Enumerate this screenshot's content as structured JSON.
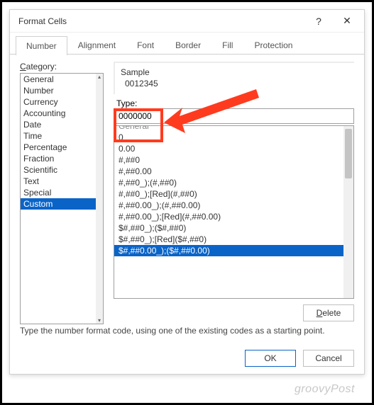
{
  "window": {
    "title": "Format Cells",
    "help": "?",
    "close": "✕"
  },
  "tabs": [
    "Number",
    "Alignment",
    "Font",
    "Border",
    "Fill",
    "Protection"
  ],
  "active_tab": 0,
  "category": {
    "label": "Category:",
    "items": [
      "General",
      "Number",
      "Currency",
      "Accounting",
      "Date",
      "Time",
      "Percentage",
      "Fraction",
      "Scientific",
      "Text",
      "Special",
      "Custom"
    ],
    "selected": 11
  },
  "sample": {
    "label": "Sample",
    "value": "0012345"
  },
  "type": {
    "label": "Type:",
    "value": "0000000"
  },
  "formats": {
    "items": [
      "General",
      "0",
      "0.00",
      "#,##0",
      "#,##0.00",
      "#,##0_);(#,##0)",
      "#,##0_);[Red](#,##0)",
      "#,##0.00_);(#,##0.00)",
      "#,##0.00_);[Red](#,##0.00)",
      "$#,##0_);($#,##0)",
      "$#,##0_);[Red]($#,##0)",
      "$#,##0.00_);($#,##0.00)"
    ],
    "top_cut": true,
    "selected": 11
  },
  "buttons": {
    "delete": "Delete",
    "ok": "OK",
    "cancel": "Cancel"
  },
  "hint": "Type the number format code, using one of the existing codes as a starting point.",
  "watermark": "groovyPost"
}
